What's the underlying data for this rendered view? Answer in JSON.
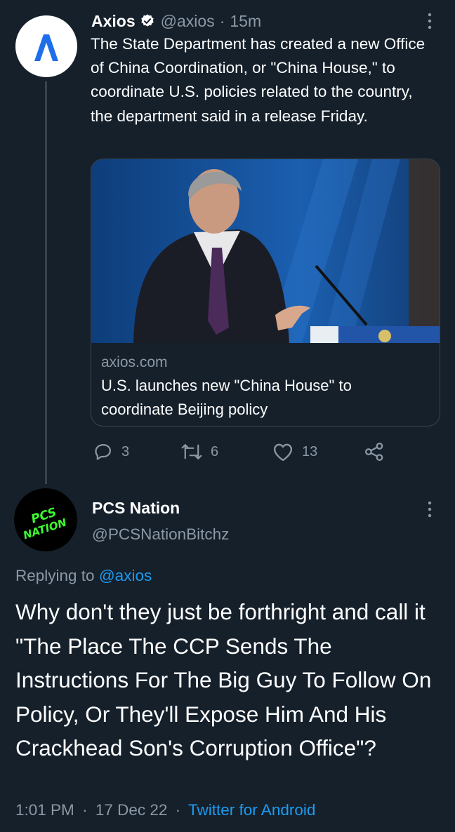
{
  "tweet": {
    "author_name": "Axios",
    "author_handle": "@axios",
    "separator": "·",
    "time_ago": "15m",
    "text": "The State Department has created a new Office of China Coordination, or \"China House,\" to coordinate U.S. policies related to the country, the department said in a release Friday.",
    "card": {
      "domain": "axios.com",
      "title": "U.S. launches new \"China House\" to coordinate Beijing policy"
    },
    "actions": {
      "reply_count": "3",
      "retweet_count": "6",
      "like_count": "13"
    },
    "icons": [
      "verified-badge-icon",
      "more-options-icon",
      "reply-icon",
      "retweet-icon",
      "like-icon",
      "share-icon"
    ]
  },
  "reply": {
    "author_name": "PCS Nation",
    "author_handle": "@PCSNationBitchz",
    "avatar_text": [
      "PCS",
      "NATION"
    ],
    "replying_prefix": "Replying to",
    "replying_to": "@axios",
    "text": "Why don't they just be forthright and call it \"The Place The CCP Sends The Instructions For The Big Guy To Follow On Policy, Or They'll Expose Him And His Crackhead Son's Corruption Office\"?",
    "time": "1:01 PM",
    "separator": "·",
    "date": "17 Dec 22",
    "client": "Twitter for Android"
  },
  "colors": {
    "background": "#15202b",
    "muted_text": "#8b98a5",
    "link": "#1d9bf0",
    "border": "#38444d",
    "avatar_logo": "#1f6feb",
    "pcs_green": "#3cff2f"
  }
}
